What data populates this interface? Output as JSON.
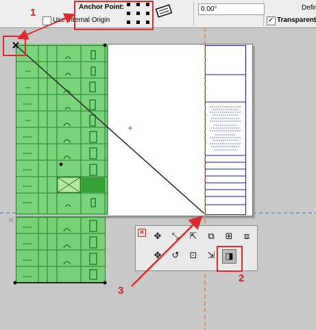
{
  "toolbar": {
    "anchor_point_label": "Anchor Point:",
    "use_internal_origin_label": "Use Internal Origin",
    "angle_value": "0.00°",
    "definition_label": "Defir",
    "transparent_label": "Transparent",
    "transparent_checked": "✓"
  },
  "callouts": {
    "one": "1",
    "two": "2",
    "three": "3"
  },
  "palette": {
    "close_glyph": "✕",
    "row1_icons": [
      "move-icon",
      "rotate-icon",
      "mirror-icon",
      "resize-icon",
      "drag-copy-icon",
      "multiply-icon"
    ],
    "row2_icons": [
      "offset-icon",
      "rotate-copy-icon",
      "stretch-icon",
      "fit-to-page-icon",
      "adjust-anchor-icon"
    ]
  },
  "colors": {
    "callout": "#e0282a",
    "selection_green": "#6fd16f",
    "guide_orange": "#e07a3a",
    "guide_blue": "#4a63c8"
  }
}
